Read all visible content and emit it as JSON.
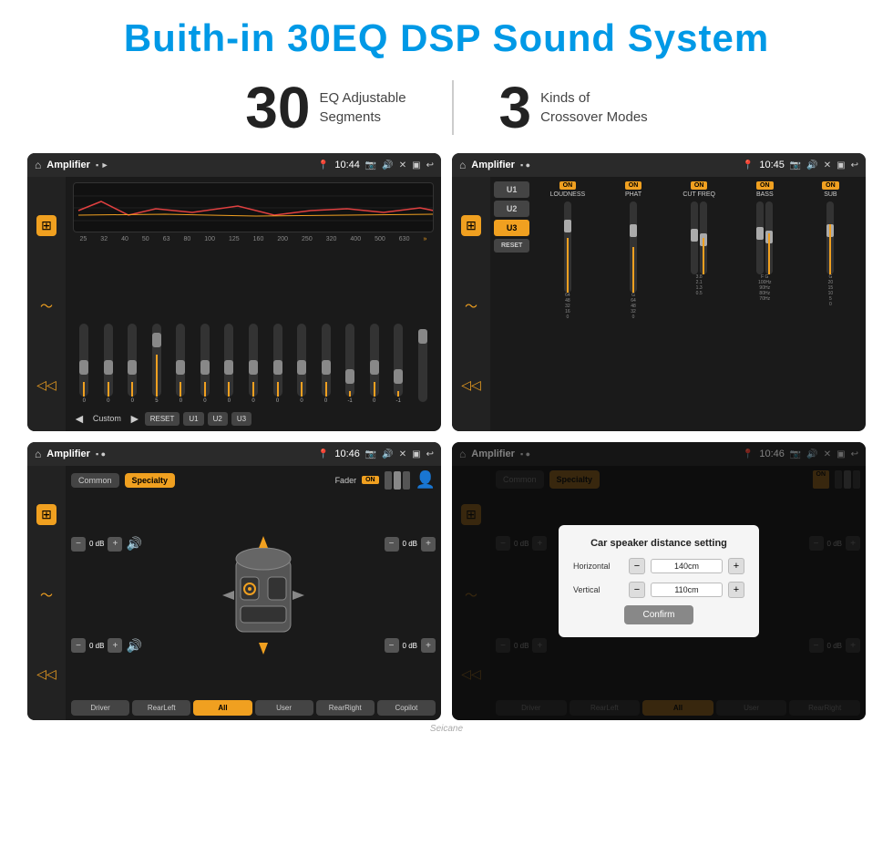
{
  "header": {
    "title": "Buith-in 30EQ DSP Sound System"
  },
  "stats": [
    {
      "number": "30",
      "label": "EQ Adjustable\nSegments"
    },
    {
      "number": "3",
      "label": "Kinds of\nCrossover Modes"
    }
  ],
  "screens": [
    {
      "id": "eq-screen",
      "topbar": {
        "title": "Amplifier",
        "time": "10:44"
      },
      "type": "eq",
      "eq_frequencies": [
        "25",
        "32",
        "40",
        "50",
        "63",
        "80",
        "100",
        "125",
        "160",
        "200",
        "250",
        "320",
        "400",
        "500",
        "630"
      ],
      "eq_values": [
        0,
        0,
        0,
        5,
        0,
        0,
        0,
        0,
        0,
        0,
        0,
        "-1",
        0,
        "-1"
      ],
      "bottom_buttons": [
        "RESET",
        "U1",
        "U2",
        "U3"
      ],
      "preset_label": "Custom"
    },
    {
      "id": "crossover-screen",
      "topbar": {
        "title": "Amplifier",
        "time": "10:45"
      },
      "type": "crossover",
      "presets": [
        "U1",
        "U2",
        "U3"
      ],
      "active_preset": "U3",
      "channels": [
        {
          "label": "LOUDNESS",
          "on": true
        },
        {
          "label": "PHAT",
          "on": true
        },
        {
          "label": "CUT FREQ",
          "on": true
        },
        {
          "label": "BASS",
          "on": true
        },
        {
          "label": "SUB",
          "on": true
        }
      ],
      "reset_label": "RESET"
    },
    {
      "id": "specialty-screen",
      "topbar": {
        "title": "Amplifier",
        "time": "10:46"
      },
      "type": "specialty",
      "tabs": [
        "Common",
        "Specialty"
      ],
      "active_tab": "Specialty",
      "fader_label": "Fader",
      "fader_on": "ON",
      "speaker_zones": [
        "Driver",
        "RearLeft",
        "Copilot",
        "RearRight"
      ],
      "active_zone": "All",
      "db_values": [
        "0 dB",
        "0 dB",
        "0 dB",
        "0 dB"
      ],
      "bottom_buttons": [
        "Driver",
        "RearLeft",
        "All",
        "User",
        "RearRight",
        "Copilot"
      ]
    },
    {
      "id": "dialog-screen",
      "topbar": {
        "title": "Amplifier",
        "time": "10:46"
      },
      "type": "dialog",
      "tabs": [
        "Common",
        "Specialty"
      ],
      "active_tab": "Specialty",
      "dialog": {
        "title": "Car speaker distance setting",
        "fields": [
          {
            "label": "Horizontal",
            "value": "140cm"
          },
          {
            "label": "Vertical",
            "value": "110cm"
          }
        ],
        "confirm_label": "Confirm"
      }
    }
  ],
  "watermark": "Seicane"
}
